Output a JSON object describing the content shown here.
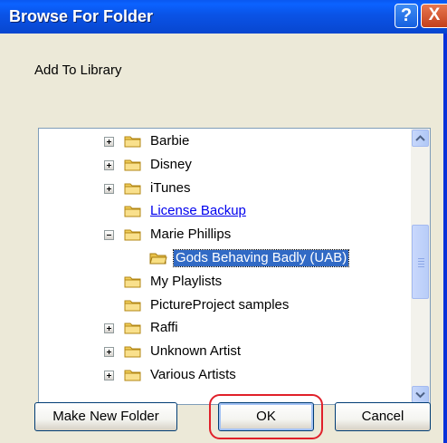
{
  "window": {
    "title": "Browse For Folder",
    "help_glyph": "?",
    "close_glyph": "X"
  },
  "instruction": "Add To Library",
  "tree": {
    "items": [
      {
        "label": "Barbie",
        "expander": "plus"
      },
      {
        "label": "Disney",
        "expander": "plus"
      },
      {
        "label": "iTunes",
        "expander": "plus"
      },
      {
        "label": "License Backup",
        "expander": "none",
        "style": "link"
      },
      {
        "label": "Marie Phillips",
        "expander": "minus"
      },
      {
        "label": "Gods Behaving Badly (UAB)",
        "expander": "none",
        "selected": true,
        "icon": "open-folder"
      },
      {
        "label": "My Playlists",
        "expander": "none"
      },
      {
        "label": "PictureProject samples",
        "expander": "none"
      },
      {
        "label": "Raffi",
        "expander": "plus"
      },
      {
        "label": "Unknown Artist",
        "expander": "plus"
      },
      {
        "label": "Various Artists",
        "expander": "plus"
      }
    ]
  },
  "buttons": {
    "make_new_folder": "Make New Folder",
    "ok": "OK",
    "cancel": "Cancel"
  },
  "colors": {
    "title_bar": "#0a53e6",
    "selection": "#316ac5",
    "link": "#0000ee",
    "highlight_ring": "#e0202a",
    "dialog_bg": "#ece9d8"
  },
  "icons": {
    "folder": "folder-icon",
    "open_folder": "open-folder-icon",
    "scroll_up": "chevron-up-icon",
    "scroll_down": "chevron-down-icon"
  }
}
